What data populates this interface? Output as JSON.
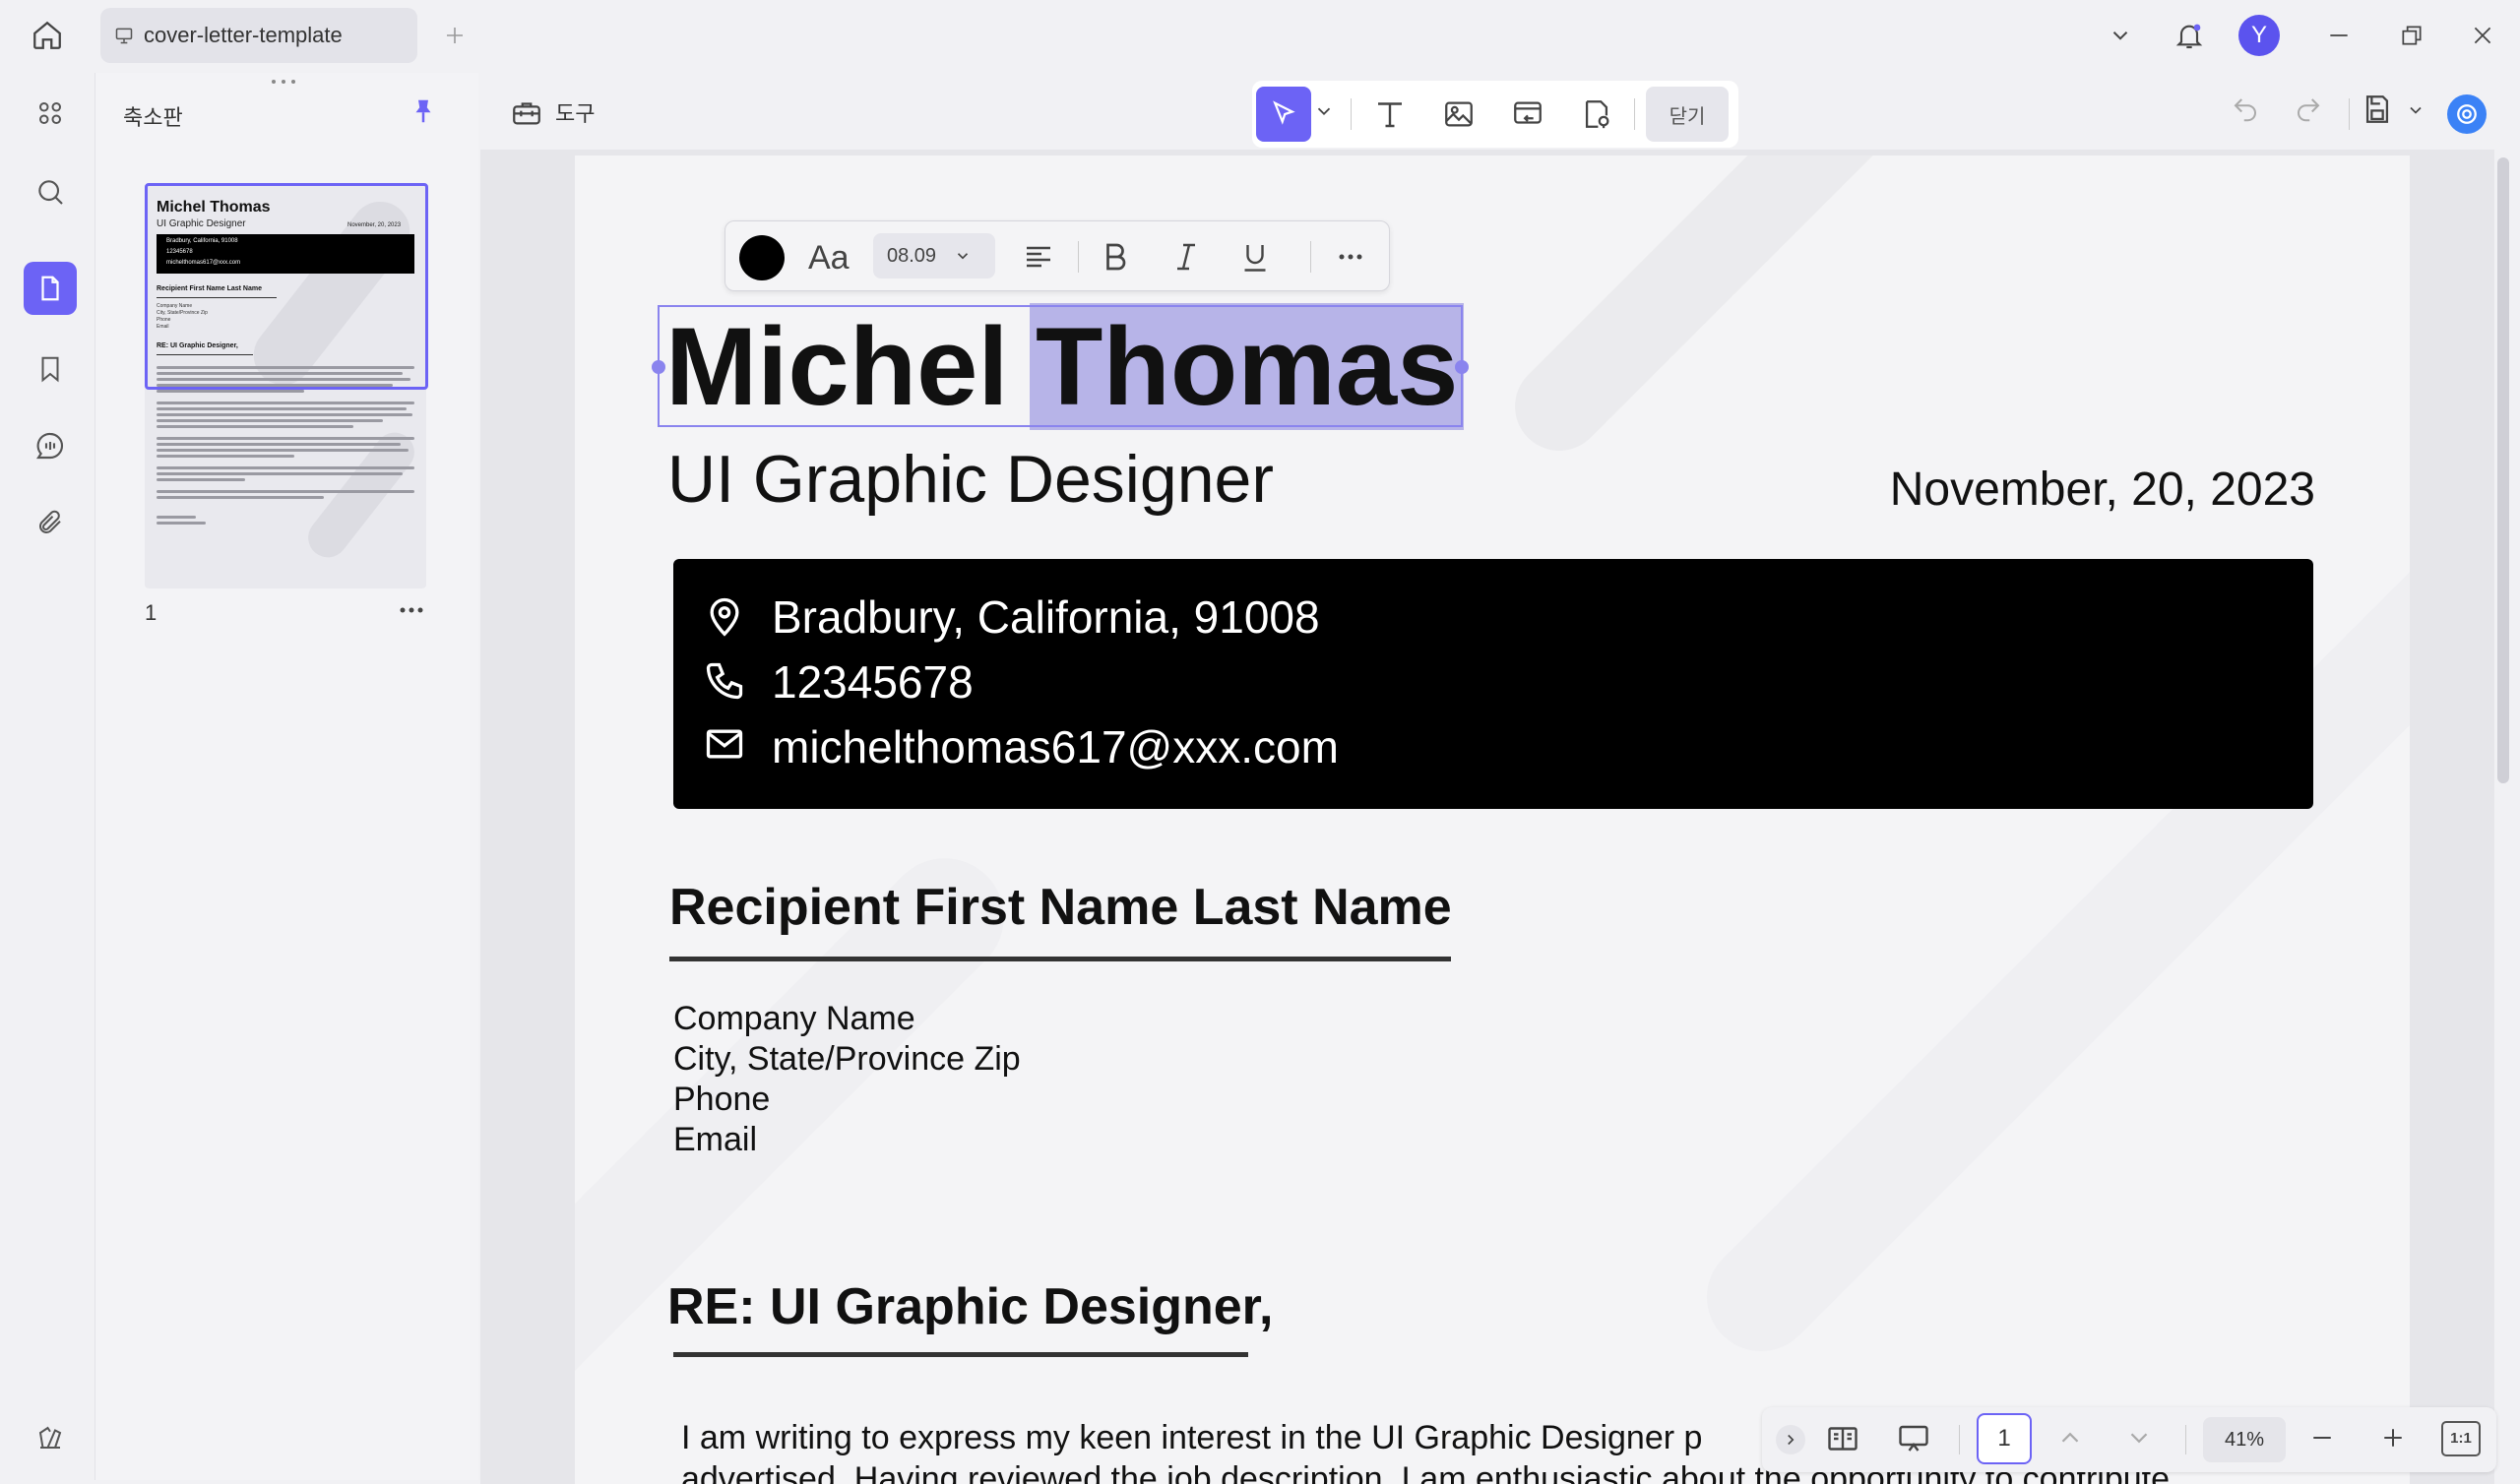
{
  "app": {
    "tab_title": "cover-letter-template",
    "avatar_letter": "Y",
    "accent_color": "#6c63f5"
  },
  "sidebar": {
    "panel_title": "축소판",
    "page_number": "1",
    "icons": [
      "grid-icon",
      "search-icon",
      "pages-icon",
      "bookmark-icon",
      "comment-icon",
      "attachment-icon"
    ]
  },
  "toolbar": {
    "tools_label": "도구",
    "close_label": "닫기"
  },
  "format_bar": {
    "font_button": "Aa",
    "font_size": "08.09",
    "text_color": "#000000"
  },
  "document": {
    "name_first": "Michel",
    "name_last": "Thomas",
    "job_title": "UI Graphic Designer",
    "date": "November, 20, 2023",
    "contact": {
      "address": "Bradbury, California, 91008",
      "phone": "12345678",
      "email": "michelthomas617@xxx.com"
    },
    "recipient_heading": "Recipient First Name Last Name",
    "recipient_lines": [
      "Company Name",
      "City, State/Province Zip",
      "Phone",
      "Email"
    ],
    "re_heading": "RE: UI Graphic Designer,",
    "body_line_1": "I am writing to express my keen interest in the UI Graphic Designer p",
    "body_line_2": "advertised. Having reviewed the job description, I am enthusiastic about the opportunity to contribute"
  },
  "thumbnail": {
    "name": "Michel Thomas",
    "job_title": "UI Graphic Designer",
    "date": "November, 20, 2023",
    "address": "Bradbury, California, 91008",
    "phone": "12345678",
    "email": "michelthomas617@xxx.com",
    "recipient_heading": "Recipient First Name Last Name",
    "recipient_lines": [
      "Company Name",
      "City, State/Province Zip",
      "Phone",
      "Email"
    ],
    "re_heading": "RE: UI Graphic Designer,"
  },
  "navigation": {
    "current_page": "1",
    "zoom": "41%",
    "fit_label": "1:1"
  }
}
